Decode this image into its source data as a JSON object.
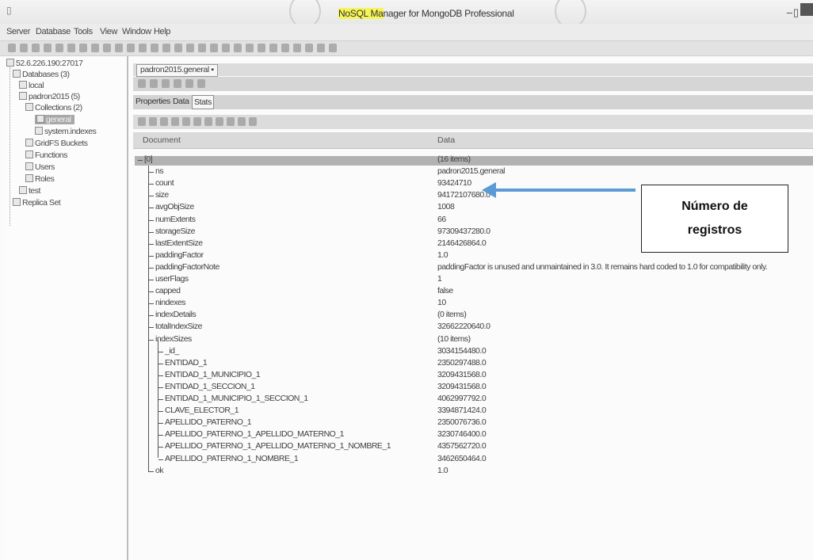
{
  "window": {
    "title_highlight": "NoSQL Ma",
    "title_rest": "nager for MongoDB Professional",
    "controls": {
      "minimize": "–",
      "restore": "▯"
    }
  },
  "menu": [
    "Server",
    "Database",
    "Tools",
    "View",
    "Window",
    "Help"
  ],
  "tree": {
    "server": "52.6.226.190:27017",
    "databases": "Databases (3)",
    "local": "local",
    "db": "padron2015 (5)",
    "collections": "Collections (2)",
    "general": "general",
    "system_indexes": "system.indexes",
    "gridfs": "GridFS Buckets",
    "functions": "Functions",
    "users": "Users",
    "roles": "Roles",
    "test": "test",
    "replica_set": "Replica Set"
  },
  "doc_tab": "padron2015.general",
  "view_tabs": [
    "Properties",
    "Data",
    "Stats"
  ],
  "grid": {
    "headers": {
      "document": "Document",
      "data": "Data"
    },
    "root": {
      "key": "[0]",
      "value": "(16 items)"
    },
    "rows": [
      {
        "key": "ns",
        "value": "padron2015.general"
      },
      {
        "key": "count",
        "value": "93424710"
      },
      {
        "key": "size",
        "value": "94172107680.0"
      },
      {
        "key": "avgObjSize",
        "value": "1008"
      },
      {
        "key": "numExtents",
        "value": "66"
      },
      {
        "key": "storageSize",
        "value": "97309437280.0"
      },
      {
        "key": "lastExtentSize",
        "value": "2146426864.0"
      },
      {
        "key": "paddingFactor",
        "value": "1.0"
      },
      {
        "key": "paddingFactorNote",
        "value": "paddingFactor is unused and unmaintained in 3.0. It remains hard coded to 1.0 for compatibility only."
      },
      {
        "key": "userFlags",
        "value": "1"
      },
      {
        "key": "capped",
        "value": "false"
      },
      {
        "key": "nindexes",
        "value": "10"
      },
      {
        "key": "indexDetails",
        "value": "(0 items)"
      },
      {
        "key": "totalIndexSize",
        "value": "32662220640.0"
      },
      {
        "key": "indexSizes",
        "value": "(10 items)"
      }
    ],
    "index_rows": [
      {
        "key": "_id_",
        "value": "3034154480.0"
      },
      {
        "key": "ENTIDAD_1",
        "value": "2350297488.0"
      },
      {
        "key": "ENTIDAD_1_MUNICIPIO_1",
        "value": "3209431568.0"
      },
      {
        "key": "ENTIDAD_1_SECCION_1",
        "value": "3209431568.0"
      },
      {
        "key": "ENTIDAD_1_MUNICIPIO_1_SECCION_1",
        "value": "4062997792.0"
      },
      {
        "key": "CLAVE_ELECTOR_1",
        "value": "3394871424.0"
      },
      {
        "key": "APELLIDO_PATERNO_1",
        "value": "2350076736.0"
      },
      {
        "key": "APELLIDO_PATERNO_1_APELLIDO_MATERNO_1",
        "value": "3230746400.0"
      },
      {
        "key": "APELLIDO_PATERNO_1_APELLIDO_MATERNO_1_NOMBRE_1",
        "value": "4357562720.0"
      },
      {
        "key": "APELLIDO_PATERNO_1_NOMBRE_1",
        "value": "3462650464.0"
      }
    ],
    "ok": {
      "key": "ok",
      "value": "1.0"
    }
  },
  "annotation": {
    "text": "Número de registros",
    "arrow_color": "#5b9bd5"
  }
}
